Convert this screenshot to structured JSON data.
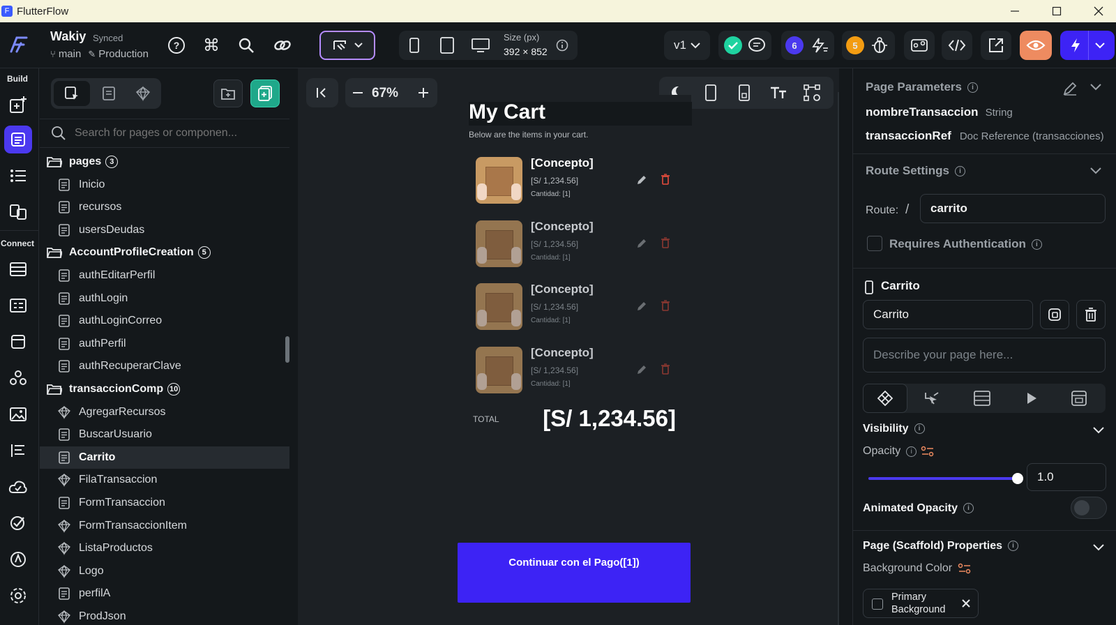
{
  "window": {
    "title": "FlutterFlow"
  },
  "project": {
    "name": "Wakiy",
    "sync_status": "Synced",
    "branch": "main",
    "environment": "Production"
  },
  "toolbar": {
    "size_label": "Size (px)",
    "size_value": "392 × 852",
    "version": "v1",
    "notif_count_1": "6",
    "notif_count_2": "5"
  },
  "rail": {
    "build_label": "Build",
    "connect_label": "Connect"
  },
  "search": {
    "placeholder": "Search for pages or componen..."
  },
  "tree": {
    "folders": [
      {
        "name": "pages",
        "count": "3"
      },
      {
        "name": "AccountProfileCreation",
        "count": "5"
      },
      {
        "name": "transaccionComp",
        "count": "10"
      }
    ],
    "pages": [
      "Inicio",
      "recursos",
      "usersDeudas"
    ],
    "account": [
      "authEditarPerfil",
      "authLogin",
      "authLoginCorreo",
      "authPerfil",
      "authRecuperarClave"
    ],
    "trans": [
      "AgregarRecursos",
      "BuscarUsuario",
      "Carrito",
      "FilaTransaccion",
      "FormTransaccion",
      "FormTransaccionItem",
      "ListaProductos",
      "Logo",
      "perfilA",
      "ProdJson"
    ]
  },
  "canvas": {
    "zoom": "67%"
  },
  "cart": {
    "title": "My Cart",
    "subtitle": "Below are the items in your cart.",
    "items": [
      {
        "name": "[Concepto]",
        "price": "[S/ 1,234.56]",
        "qty": "Cantidad: [1]"
      },
      {
        "name": "[Concepto]",
        "price": "[S/ 1,234.56]",
        "qty": "Cantidad: [1]"
      },
      {
        "name": "[Concepto]",
        "price": "[S/ 1,234.56]",
        "qty": "Cantidad: [1]"
      },
      {
        "name": "[Concepto]",
        "price": "[S/ 1,234.56]",
        "qty": "Cantidad: [1]"
      }
    ],
    "total_label": "TOTAL",
    "total_value": "[S/ 1,234.56]",
    "cta": "Continuar con el Pago([1])"
  },
  "right": {
    "params_title": "Page Parameters",
    "params": [
      {
        "name": "nombreTransaccion",
        "type": "String"
      },
      {
        "name": "transaccionRef",
        "type": "Doc Reference (transacciones)"
      }
    ],
    "route_title": "Route Settings",
    "route_label": "Route:",
    "route_slash": "/",
    "route_value": "carrito",
    "requires_auth": "Requires Authentication",
    "widget_name": "Carrito",
    "name_value": "Carrito",
    "describe_placeholder": "Describe your page here...",
    "visibility": "Visibility",
    "opacity": "Opacity",
    "opacity_value": "1.0",
    "opacity_fraction": 1.0,
    "animated_opacity": "Animated Opacity",
    "scaffold_title": "Page (Scaffold) Properties",
    "bg_color_label": "Background Color",
    "bg_color_value": "Primary Background"
  },
  "colors": {
    "accent": "#4b39ef",
    "primary_btn": "#3d23f5",
    "danger": "#e74c3c",
    "selected_bg": "#262b30"
  }
}
